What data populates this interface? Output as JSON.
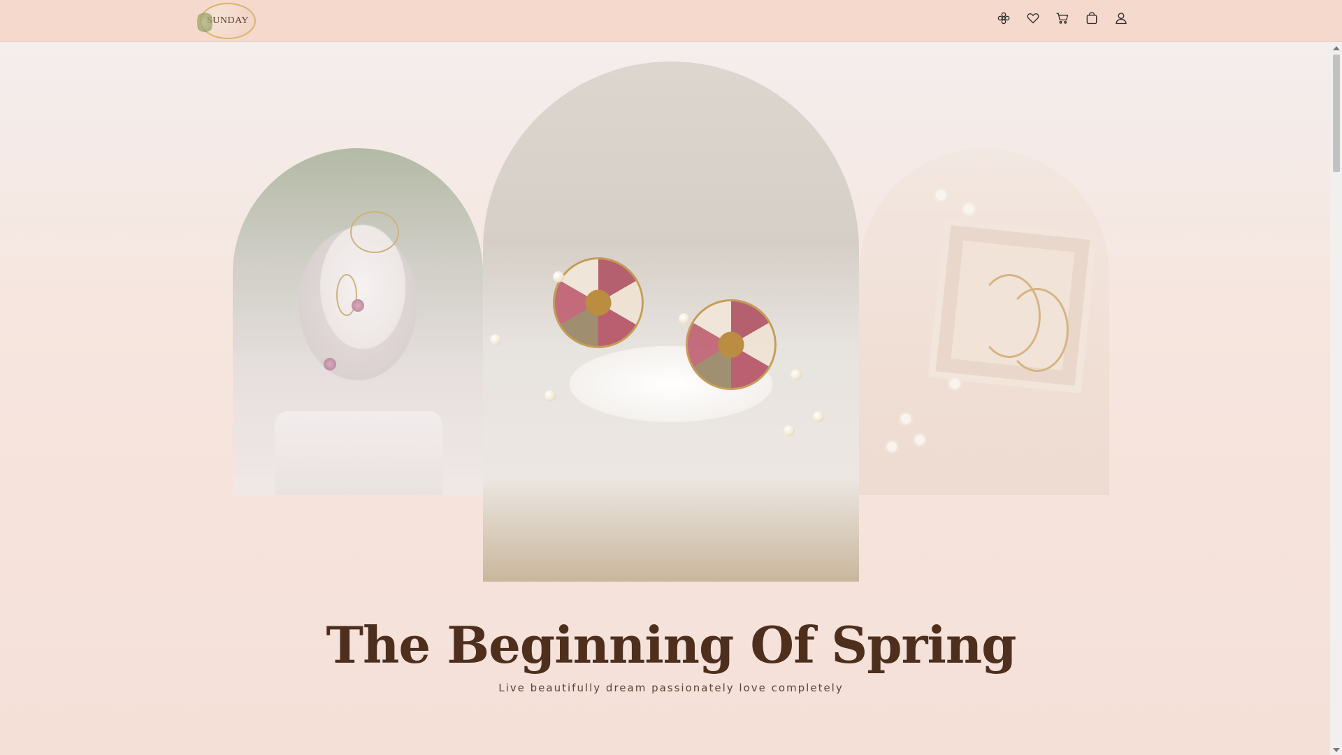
{
  "header": {
    "logo_text": "SUNDAY",
    "icons": [
      {
        "name": "flower-icon"
      },
      {
        "name": "heart-icon"
      },
      {
        "name": "cart-icon"
      },
      {
        "name": "bag-icon"
      },
      {
        "name": "user-icon"
      }
    ]
  },
  "hero": {
    "title": "The Beginning Of Spring",
    "subtitle": "Live beautifully dream passionately love completely"
  },
  "colors": {
    "header_bg": "#f5d9cc",
    "title": "#4e2f1e",
    "subtitle": "#5a4437"
  }
}
